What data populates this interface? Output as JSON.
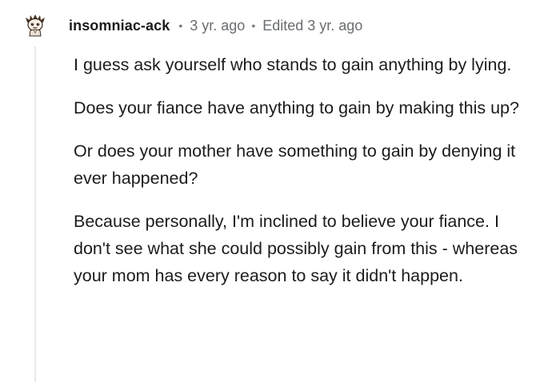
{
  "comment": {
    "author": "insomniac-ack",
    "separator": "•",
    "timestamp": "3 yr. ago",
    "edited": "Edited 3 yr. ago",
    "avatar_icon": "snoo-avatar-icon",
    "paragraphs": [
      "I guess ask yourself who stands to gain anything by lying.",
      "Does your fiance have anything to gain by making this up?",
      "Or does your mother have something to gain by denying it ever happened?",
      "Because personally, I'm inclined to believe your fiance. I don't see what she could possibly gain from this - whereas your mom has every reason to say it didn't happen."
    ]
  },
  "colors": {
    "text": "#1c1c1c",
    "meta": "#6a6d70",
    "thread_line": "#e6e8ea",
    "background": "#ffffff"
  }
}
